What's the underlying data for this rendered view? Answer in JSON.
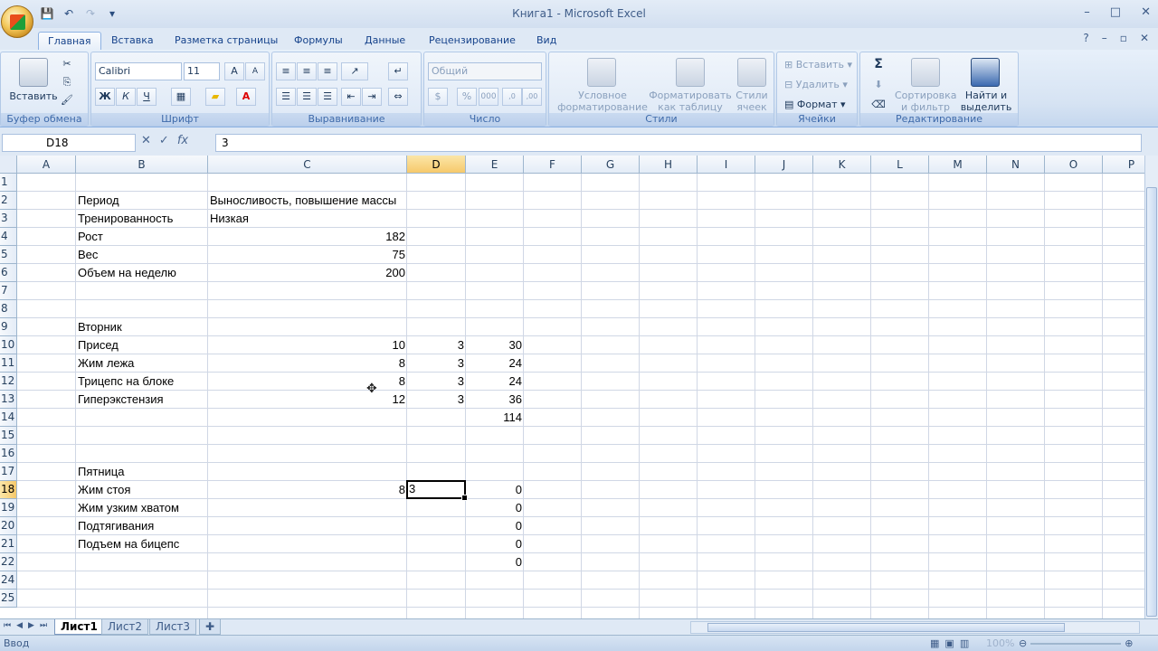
{
  "window": {
    "title": "Книга1 - Microsoft Excel"
  },
  "tabs": [
    {
      "label": "Главная",
      "active": true
    },
    {
      "label": "Вставка"
    },
    {
      "label": "Разметка страницы"
    },
    {
      "label": "Формулы"
    },
    {
      "label": "Данные"
    },
    {
      "label": "Рецензирование"
    },
    {
      "label": "Вид"
    }
  ],
  "ribbon": {
    "clipboard": {
      "label": "Буфер обмена",
      "paste": "Вставить"
    },
    "font": {
      "label": "Шрифт",
      "name": "Calibri",
      "size": "11",
      "bold": "Ж",
      "italic": "К",
      "underline": "Ч"
    },
    "alignment": {
      "label": "Выравнивание"
    },
    "number": {
      "label": "Число",
      "format": "Общий"
    },
    "styles": {
      "label": "Стили",
      "conditional": "Условное форматирование",
      "as_table": "Форматировать как таблицу",
      "cell_styles": "Стили ячеек"
    },
    "cells": {
      "label": "Ячейки",
      "insert": "Вставить",
      "delete": "Удалить",
      "format": "Формат"
    },
    "editing": {
      "label": "Редактирование",
      "sort": "Сортировка и фильтр",
      "find": "Найти и выделить"
    }
  },
  "formula_bar": {
    "name_box": "D18",
    "fx": "fx",
    "value": "3"
  },
  "columns": [
    "A",
    "B",
    "C",
    "D",
    "E",
    "F",
    "G",
    "H",
    "I",
    "J",
    "K",
    "L",
    "M",
    "N",
    "O",
    "P"
  ],
  "rows": [
    "1",
    "2",
    "3",
    "4",
    "5",
    "6",
    "7",
    "8",
    "9",
    "10",
    "11",
    "12",
    "13",
    "14",
    "15",
    "16",
    "17",
    "18",
    "19",
    "20",
    "21",
    "22",
    "24",
    "25"
  ],
  "cells": {
    "B2": "Период",
    "C2": "Выносливость, повышение массы",
    "B3": "Тренированность",
    "C3": "Низкая",
    "B4": "Рост",
    "C4": "182",
    "B5": "Вес",
    "C5": "75",
    "B6": "Объем на неделю",
    "C6": "200",
    "B9": "Вторник",
    "B10": "Присед",
    "C10": "10",
    "D10": "3",
    "E10": "30",
    "B11": "Жим лежа",
    "C11": "8",
    "D11": "3",
    "E11": "24",
    "B12": "Трицепс на блоке",
    "C12": "8",
    "D12": "3",
    "E12": "24",
    "B13": "Гиперэкстензия",
    "C13": "12",
    "D13": "3",
    "E13": "36",
    "E14": "114",
    "B17": "Пятница",
    "B18": "Жим стоя",
    "C18": "8",
    "D18": "3",
    "E18": "0",
    "B19": "Жим узким хватом",
    "E19": "0",
    "B20": "Подтягивания",
    "E20": "0",
    "B21": "Подъем на бицепс",
    "E21": "0",
    "E22": "0"
  },
  "sheets": [
    {
      "label": "Лист1",
      "active": true
    },
    {
      "label": "Лист2"
    },
    {
      "label": "Лист3"
    }
  ],
  "status": {
    "mode": "Ввод",
    "zoom": "100%"
  }
}
